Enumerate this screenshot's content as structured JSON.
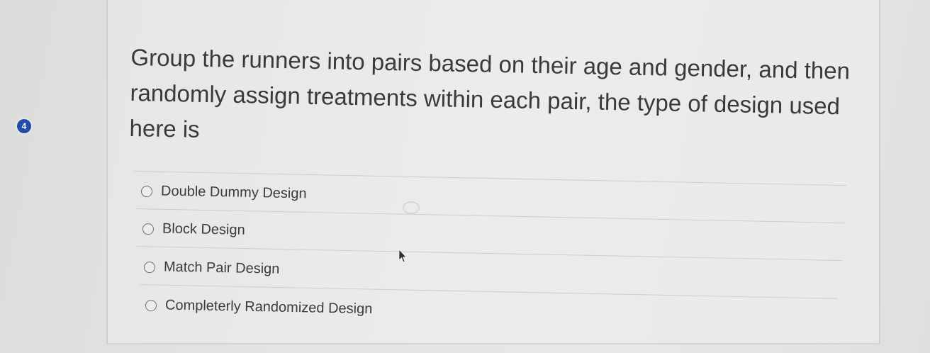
{
  "question": {
    "number": "4",
    "text": "Group the runners into pairs based on their age and gender, and then randomly assign treatments within each pair, the type of design used here is"
  },
  "options": [
    {
      "label": "Double Dummy Design"
    },
    {
      "label": "Block Design"
    },
    {
      "label": "Match Pair Design"
    },
    {
      "label": "Completerly Randomized Design"
    }
  ],
  "icons": {
    "question_number": "number-badge-icon",
    "radio": "radio-button-icon",
    "cursor": "mouse-pointer-icon"
  },
  "colors": {
    "badge": "#1f4fa8",
    "text": "#3a3a3a"
  }
}
